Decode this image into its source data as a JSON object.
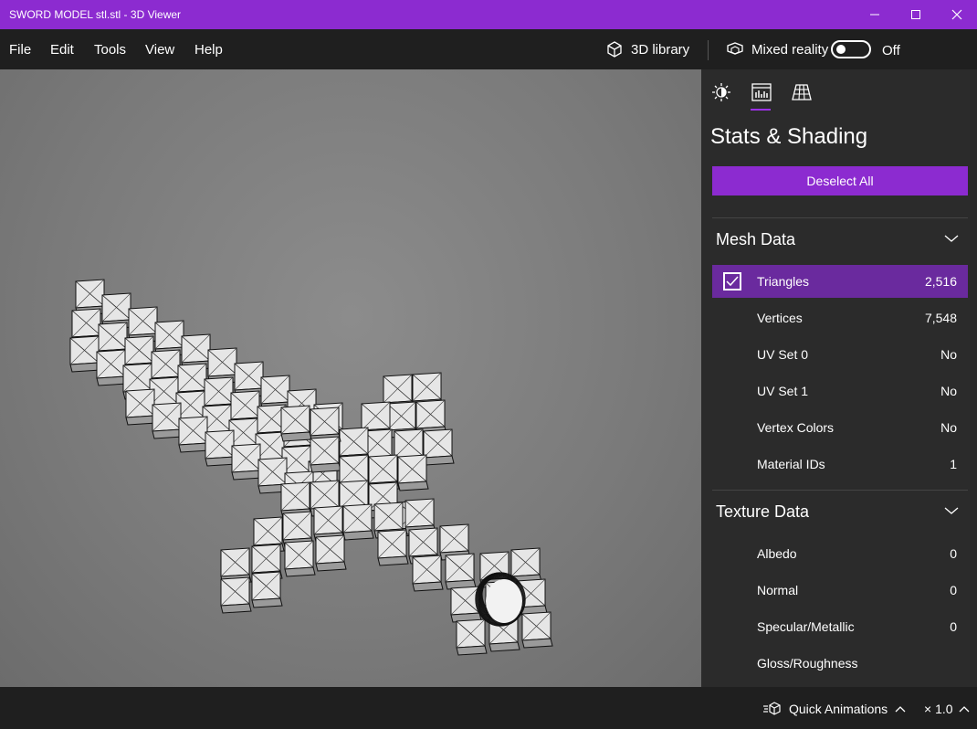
{
  "window": {
    "title": "SWORD MODEL stl.stl - 3D Viewer"
  },
  "menu": {
    "items": [
      "File",
      "Edit",
      "Tools",
      "View",
      "Help"
    ]
  },
  "toolbar": {
    "library_label": "3D library",
    "mixed_reality_label": "Mixed reality",
    "toggle_state": "Off"
  },
  "panel": {
    "title": "Stats & Shading",
    "deselect_label": "Deselect All",
    "mesh_section": "Mesh Data",
    "mesh_rows": [
      {
        "label": "Triangles",
        "value": "2,516",
        "checked": true
      },
      {
        "label": "Vertices",
        "value": "7,548"
      },
      {
        "label": "UV Set 0",
        "value": "No"
      },
      {
        "label": "UV Set 1",
        "value": "No"
      },
      {
        "label": "Vertex Colors",
        "value": "No"
      },
      {
        "label": "Material IDs",
        "value": "1"
      }
    ],
    "texture_section": "Texture Data",
    "texture_rows": [
      {
        "label": "Albedo",
        "value": "0"
      },
      {
        "label": "Normal",
        "value": "0"
      },
      {
        "label": "Specular/Metallic",
        "value": "0"
      },
      {
        "label": "Gloss/Roughness",
        "value": ""
      }
    ]
  },
  "status": {
    "quick_animations_label": "Quick Animations",
    "speed_label": "× 1.0"
  },
  "colors": {
    "accent": "#8c2bd0",
    "selected_row": "#6a2a9e",
    "panel_bg": "#2b2b2b",
    "viewport_bg": "#7f7f7f"
  }
}
